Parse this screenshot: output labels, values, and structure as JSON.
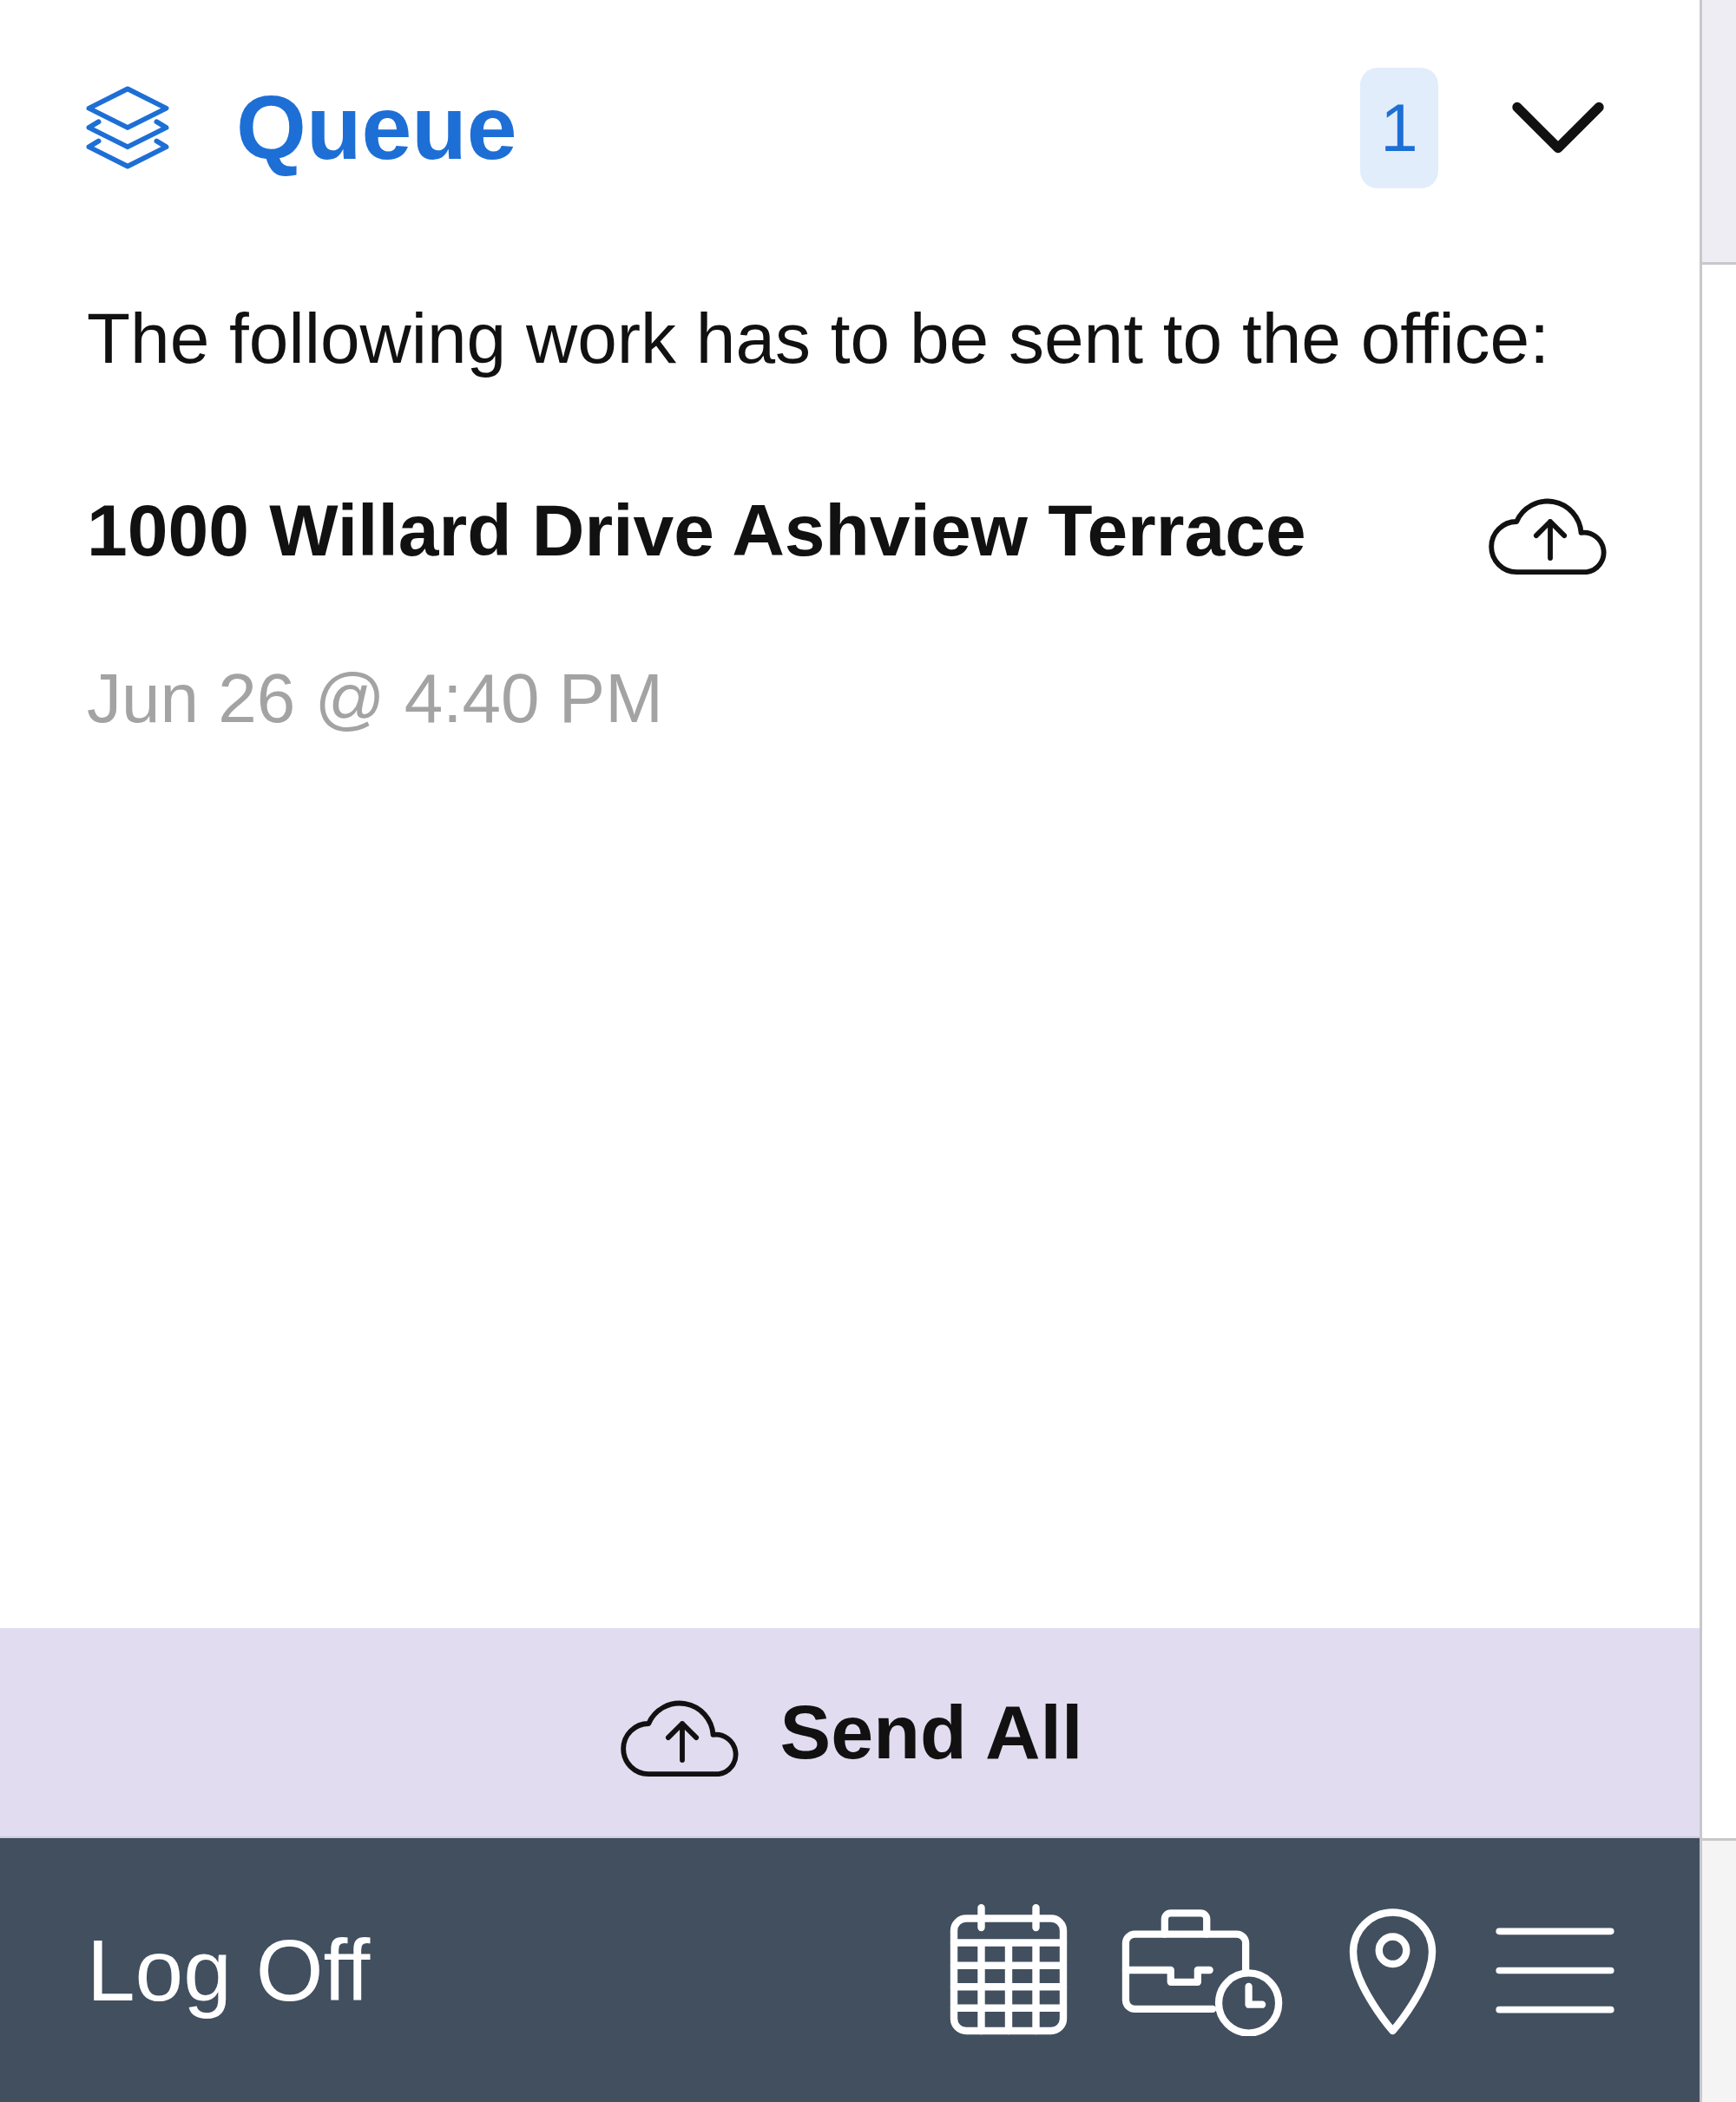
{
  "header": {
    "title": "Queue",
    "count": "1",
    "expanded": true
  },
  "message": "The following work has to be sent to the office:",
  "items": [
    {
      "title": "1000 Willard Drive Ashview Terrace",
      "timestamp": "Jun 26 @ 4:40 PM"
    }
  ],
  "send_all_button": {
    "label": "Send All"
  },
  "bottom_bar": {
    "log_off": "Log Off"
  }
}
